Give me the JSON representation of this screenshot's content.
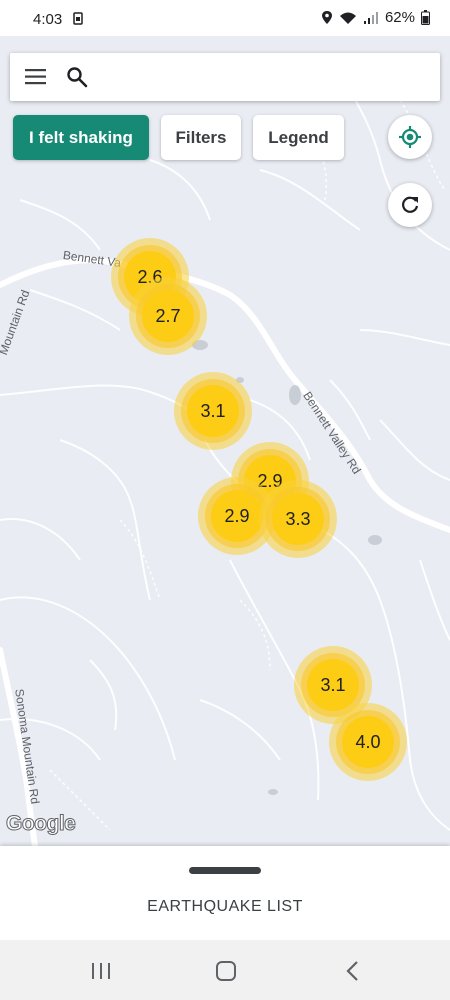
{
  "status_bar": {
    "time": "4:03",
    "battery_pct": "62%",
    "icons": [
      "sim-icon",
      "location-icon",
      "wifi-icon",
      "signal-icon",
      "battery-icon"
    ]
  },
  "search": {
    "placeholder": "",
    "icons": [
      "menu-icon",
      "search-icon"
    ]
  },
  "chips": {
    "felt_shaking": "I felt shaking",
    "filters": "Filters",
    "legend": "Legend"
  },
  "map": {
    "road_labels": {
      "bennett_valley_rd_top": "Bennett Va",
      "bennett_valley_rd_right": "Bennett Valley Rd",
      "mountain_rd_left": "Mountain Rd",
      "sonoma_mountain_rd": "Sonoma Mountain Rd"
    },
    "attribution": "Google",
    "colors": {
      "land": "#e9ecf3",
      "road": "#ffffff",
      "water": "#c8cdd6",
      "quake_core": "#fccd14",
      "accent": "#168a74"
    },
    "earthquakes": [
      {
        "magnitude": "2.6"
      },
      {
        "magnitude": "2.7"
      },
      {
        "magnitude": "3.1"
      },
      {
        "magnitude": "2.9"
      },
      {
        "magnitude": "2.9"
      },
      {
        "magnitude": "3.3"
      },
      {
        "magnitude": "3.1"
      },
      {
        "magnitude": "4.0"
      }
    ]
  },
  "bottom_sheet": {
    "title": "EARTHQUAKE LIST"
  },
  "nav_bar": {
    "icons": [
      "recent-apps-icon",
      "home-icon",
      "back-icon"
    ]
  }
}
